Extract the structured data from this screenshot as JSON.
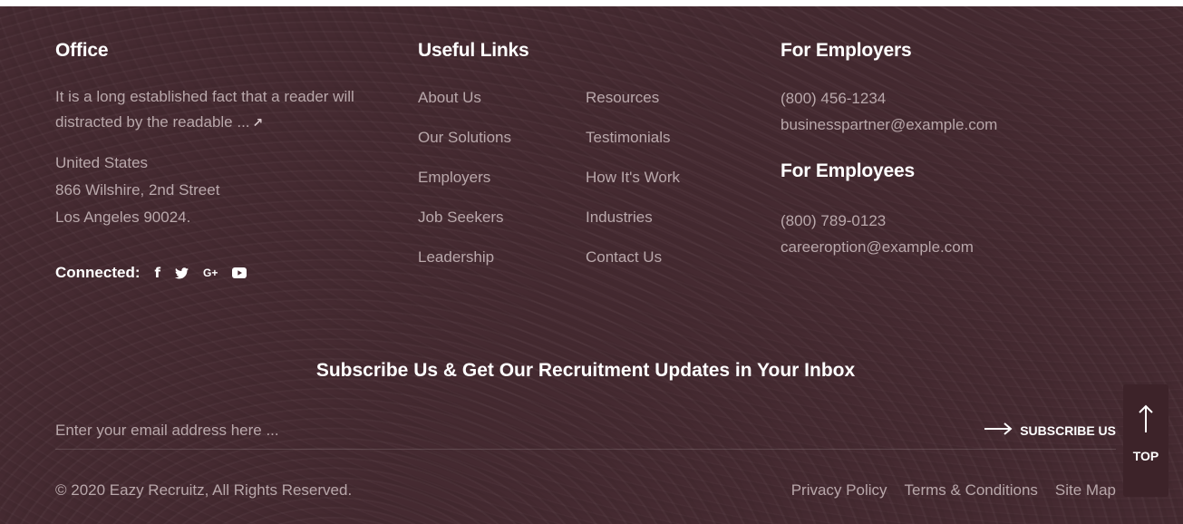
{
  "office": {
    "heading": "Office",
    "description": "It is a long established fact that a reader will distracted by the readable ...",
    "read_more_icon": "arrow-up-right-icon",
    "address_lines": [
      "United States",
      "866 Wilshire, 2nd Street",
      "Los Angeles 90024."
    ],
    "connected_label": "Connected:",
    "social": [
      {
        "name": "facebook-icon",
        "glyph": "f"
      },
      {
        "name": "twitter-icon"
      },
      {
        "name": "google-plus-icon",
        "glyph": "G+"
      },
      {
        "name": "youtube-icon"
      }
    ]
  },
  "useful_links": {
    "heading": "Useful Links",
    "col1": [
      "About Us",
      "Our Solutions",
      "Employers",
      "Job Seekers",
      "Leadership"
    ],
    "col2": [
      "Resources",
      "Testimonials",
      "How It's Work",
      "Industries",
      "Contact Us"
    ]
  },
  "employers": {
    "heading": "For Employers",
    "phone": "(800) 456-1234",
    "email": "businesspartner@example.com"
  },
  "employees": {
    "heading": "For Employees",
    "phone": "(800) 789-0123",
    "email": "careeroption@example.com"
  },
  "subscribe": {
    "title": "Subscribe Us & Get Our Recruitment Updates in Your Inbox",
    "placeholder": "Enter your email address here ...",
    "button_label": "SUBSCRIBE US",
    "button_icon": "arrow-right-icon"
  },
  "bottom": {
    "copyright": "© 2020 Eazy Recruitz, All Rights Reserved.",
    "links": [
      "Privacy Policy",
      "Terms & Conditions",
      "Site Map"
    ]
  },
  "back_to_top": {
    "label": "TOP",
    "icon": "arrow-up-icon"
  },
  "colors": {
    "background": "#452a31",
    "heading": "#ffffff",
    "text": "#b9a8ab",
    "top_button": "#3d2329"
  }
}
